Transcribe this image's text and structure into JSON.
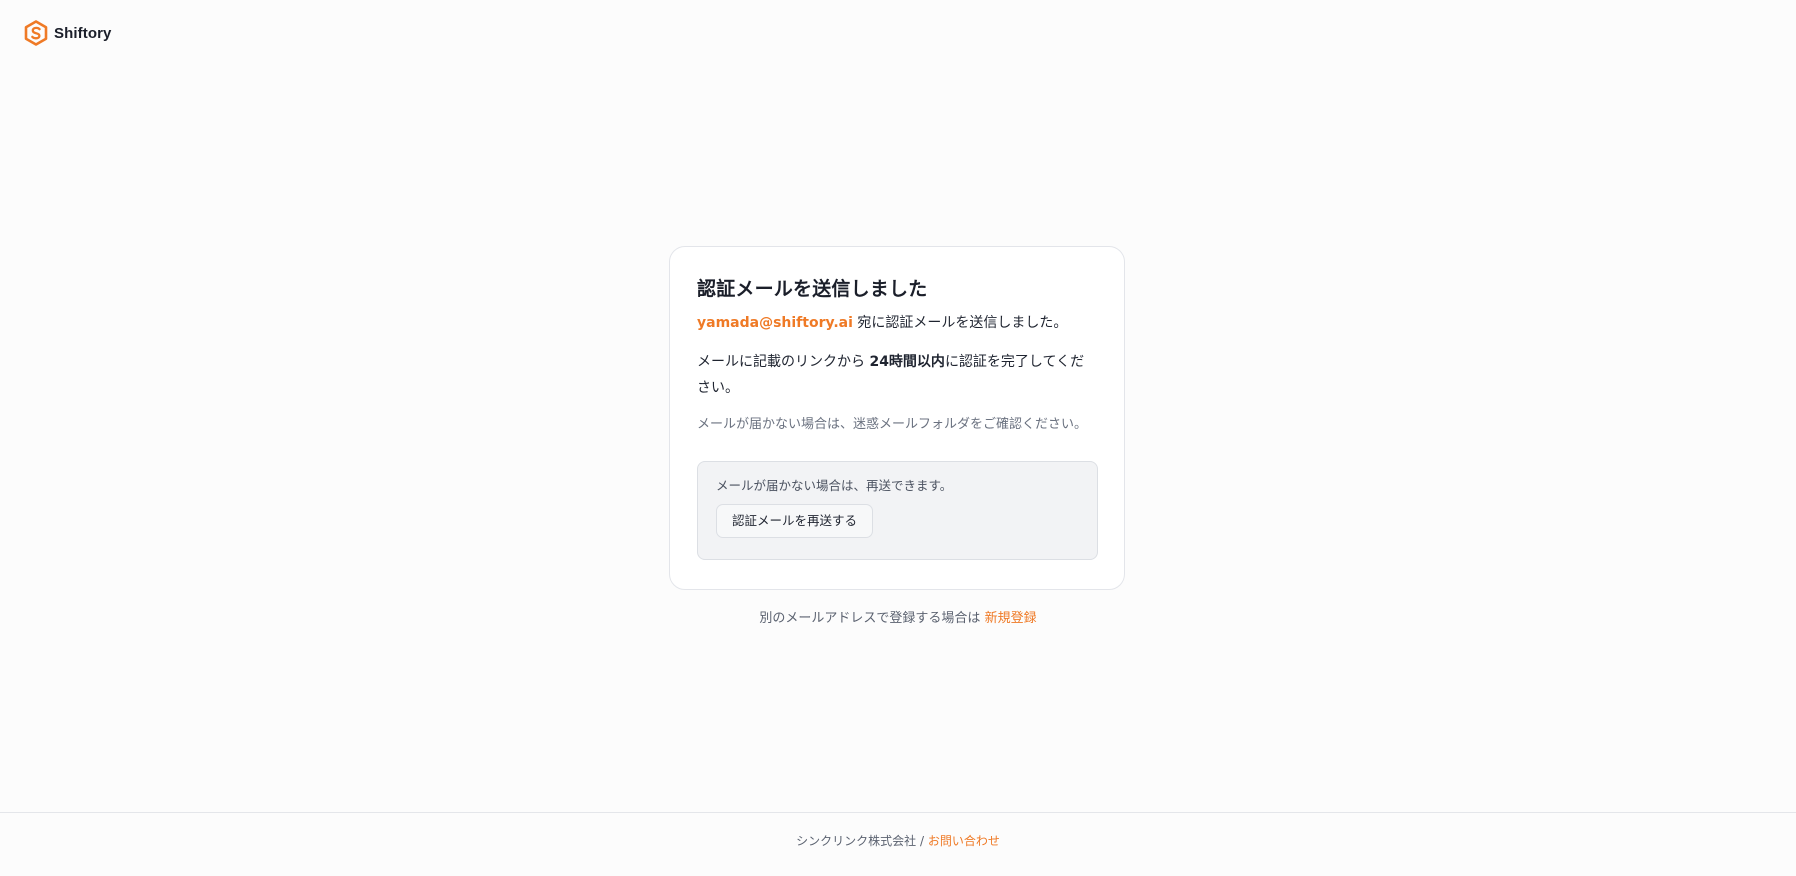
{
  "brand": {
    "name": "Shiftory",
    "accent_color": "#ef7a26",
    "logo_icon": "hexagon-s-logo-icon"
  },
  "card": {
    "title": "認証メールを送信しました",
    "email": "yamada@shiftory.ai",
    "email_suffix": " 宛に認証メールを送信しました。",
    "link_prefix": "メールに記載のリンクから ",
    "link_bold": "24時間以内",
    "link_suffix": "に認証を完了してください。",
    "spam_note": "メールが届かない場合は、迷惑メールフォルダをご確認ください。",
    "resend": {
      "note": "メールが届かない場合は、再送できます。",
      "button_label": "認証メールを再送する"
    }
  },
  "alt_register": {
    "text": "別のメールアドレスで登録する場合は ",
    "link_label": "新規登録"
  },
  "footer": {
    "company": "シンクリンク株式会社 / ",
    "contact_label": "お問い合わせ"
  }
}
